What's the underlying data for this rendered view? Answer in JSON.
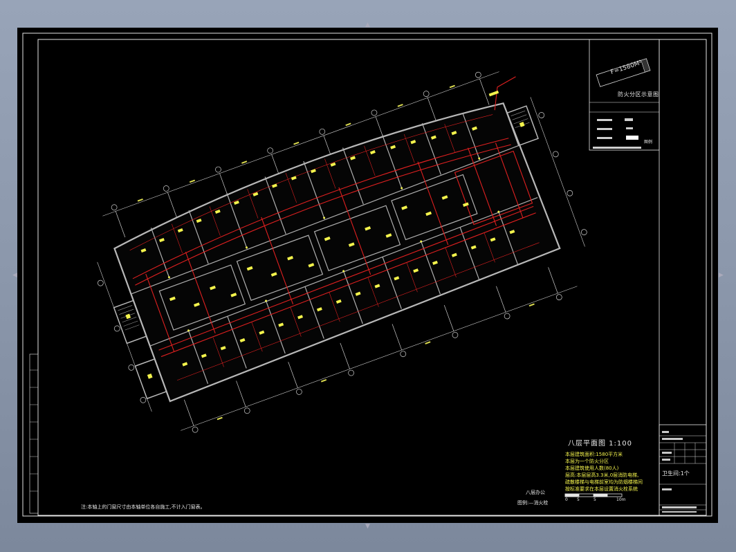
{
  "drawing": {
    "fire_zone_diagram": {
      "area_label": "F=1580M²",
      "title": "防火分区示意图"
    },
    "legend_marker": "图例",
    "plan_title": "八层平面图 1:100",
    "notes": [
      "本层建筑面积:1580平方米",
      "本层为一个防火分区",
      "本层建筑使用人数(80人)",
      "层高:本层层高3.3米,0层消防电梯,",
      "疏散楼梯与电梯前室均为防烟楼梯间",
      "按标准要求在本层设置消火栓系统"
    ],
    "scale_bar_labels": [
      "0",
      "5",
      "5",
      "10m"
    ],
    "room_label": "八层办公",
    "hydrant_label": "图例:—消火栓",
    "footnote": "注:本轴上的门窗尺寸由本轴单位各自施工,不计入门窗表。",
    "title_block": {
      "toilet_count": "卫生间:1个"
    }
  },
  "colors": {
    "background": "#000000",
    "frame": "#e6e6e6",
    "walls": "#b8b8b8",
    "red_lines": "#e02020",
    "yellow": "#f3f34c"
  }
}
